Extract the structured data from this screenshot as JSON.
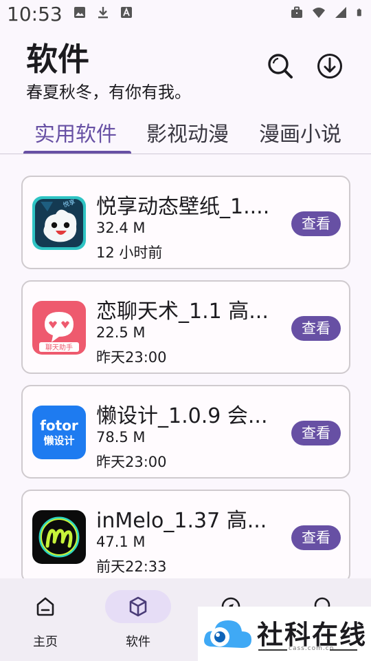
{
  "status_bar": {
    "time": "10:53",
    "left_icons": [
      "image-icon",
      "download-icon",
      "font-icon"
    ],
    "right_icons": [
      "briefcase-icon",
      "wifi-icon",
      "signal-icon",
      "battery-icon"
    ]
  },
  "header": {
    "title": "软件",
    "subtitle": "春夏秋冬，有你有我。",
    "actions": [
      "search-icon",
      "download-icon"
    ]
  },
  "tabs": [
    {
      "label": "实用软件",
      "active": true
    },
    {
      "label": "影视动漫",
      "active": false
    },
    {
      "label": "漫画小说",
      "active": false
    }
  ],
  "apps": [
    {
      "title": "悦享动态壁纸_1....",
      "size": "32.4 M",
      "time": "12 小时前",
      "button": "查看",
      "icon": "yuexiang-wallpaper-app-icon"
    },
    {
      "title": "恋聊天术_1.1 高...",
      "size": "22.5 M",
      "time": "昨天23:00",
      "button": "查看",
      "icon": "lianliao-chat-app-icon",
      "icon_label": "聊天助手"
    },
    {
      "title": "懒设计_1.0.9 会...",
      "size": "78.5 M",
      "time": "昨天23:00",
      "button": "查看",
      "icon": "fotor-design-app-icon",
      "icon_label_1": "fotor",
      "icon_label_2": "懒设计"
    },
    {
      "title": "inMelo_1.37 高...",
      "size": "47.1 M",
      "time": "前天22:33",
      "button": "查看",
      "icon": "inmelo-app-icon"
    }
  ],
  "bottom_nav": [
    {
      "label": "主页",
      "icon": "home-icon",
      "active": false
    },
    {
      "label": "软件",
      "icon": "package-icon",
      "active": true
    },
    {
      "label": "",
      "icon": "compass-icon",
      "active": false
    },
    {
      "label": "",
      "icon": "search-icon",
      "active": false
    }
  ],
  "watermark": {
    "text": "社科在线",
    "url": "cass.com.cn"
  },
  "colors": {
    "primary": "#6750A4",
    "background": "#FBF7FD",
    "nav_background": "#F1EDF4",
    "active_pill": "#E6DDF6"
  }
}
